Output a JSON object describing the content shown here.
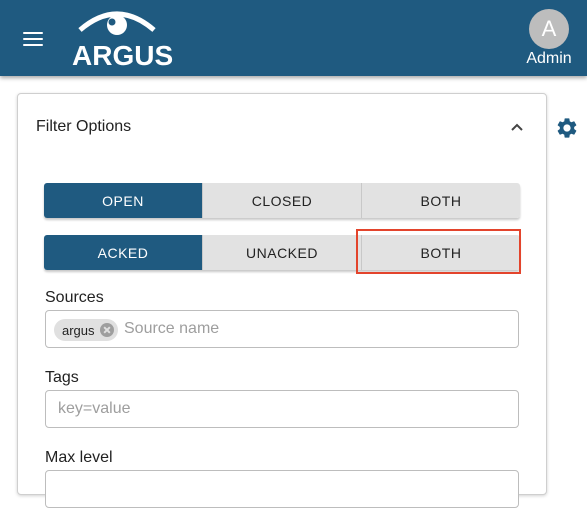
{
  "header": {
    "logo_text": "ARGUS",
    "user_initial": "A",
    "user_name": "Admin"
  },
  "filter": {
    "title": "Filter Options",
    "open_group": [
      "OPEN",
      "CLOSED",
      "BOTH"
    ],
    "ack_group": [
      "ACKED",
      "UNACKED",
      "BOTH"
    ],
    "sources_label": "Sources",
    "sources_chip": "argus",
    "sources_placeholder": "Source name",
    "tags_label": "Tags",
    "tags_placeholder": "key=value",
    "max_level_label": "Max level"
  },
  "colors": {
    "brand": "#1f5a80",
    "highlight": "#e3442c"
  }
}
